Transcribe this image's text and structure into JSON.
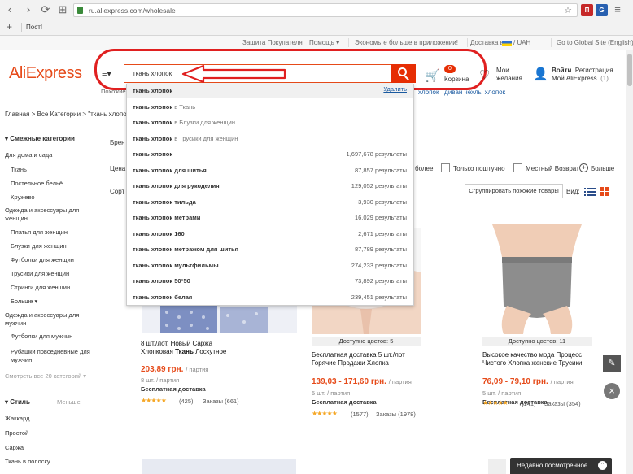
{
  "browser": {
    "url": "ru.aliexpress.com/wholesale",
    "bookmark": "Пост!"
  },
  "topbar": {
    "buyer_protection": "Защита Покупателя",
    "help": "Помощь ▾",
    "app": "Экономьте больше в приложении!",
    "delivery": "Доставка в",
    "currency": "/ UAH",
    "global_site": "Go to Global Site (English)"
  },
  "header": {
    "logo": "AliExpress",
    "category_icon": "≡▾",
    "category_label": "Похожие",
    "search_value": "ткань хлопок",
    "cart_badge": "0",
    "cart_label": "Корзина",
    "wish_label": "Мои желания",
    "login": "Войти",
    "register": "Регистрация",
    "my_ali": "Мой AliExpress",
    "my_ali_count": "(1)"
  },
  "breadcrumb": "Главная > Все Категории > \"ткань хлопок\"",
  "related_links": {
    "first": "хлопок",
    "second": "диван чехлы хлопок"
  },
  "dropdown": {
    "delete_label": "Удалить",
    "rows": [
      {
        "q": "ткань хлопок",
        "cat": "",
        "count": "",
        "history": true
      },
      {
        "q": "ткань хлопок",
        "cat": "в Ткань",
        "count": ""
      },
      {
        "q": "ткань хлопок",
        "cat": "в Блузки для женщин",
        "count": ""
      },
      {
        "q": "ткань хлопок",
        "cat": "в Трусики для женщин",
        "count": ""
      },
      {
        "q": "ткань хлопок",
        "cat": "",
        "count": "1,697,678 результаты"
      },
      {
        "q": "ткань хлопок для шитья",
        "cat": "",
        "count": "87,857 результаты"
      },
      {
        "q": "ткань хлопок для рукоделия",
        "cat": "",
        "count": "129,052 результаты"
      },
      {
        "q": "ткань хлопок тильда",
        "cat": "",
        "count": "3,930 результаты"
      },
      {
        "q": "ткань хлопок метрами",
        "cat": "",
        "count": "16,029 результаты"
      },
      {
        "q": "ткань хлопок 160",
        "cat": "",
        "count": "2,671 результаты"
      },
      {
        "q": "ткань хлопок метражом для шитья",
        "cat": "",
        "count": "87,789 результаты"
      },
      {
        "q": "ткань хлопок мультфильмы",
        "cat": "",
        "count": "274,233 результаты"
      },
      {
        "q": "ткань хлопок 50*50",
        "cat": "",
        "count": "73,892 результаты"
      },
      {
        "q": "ткань хлопок белая",
        "cat": "",
        "count": "239,451 результаты"
      }
    ]
  },
  "sidebar": {
    "heading": "Смежные категории",
    "items": [
      "Для дома и сада",
      "Ткань",
      "Постельное бельё",
      "Кружево",
      "Одежда и аксессуары для женщин",
      "Платья для женщин",
      "Блузки для женщин",
      "Футболки для женщин",
      "Трусики для женщин",
      "Стринги для женщин",
      "Больше",
      "Одежда и аксессуары для мужчин",
      "Футболки для мужчин",
      "Рубашки повседневные для мужчин"
    ],
    "see_all": "Смотреть все 20 категорий",
    "style_heading": "Стиль",
    "style_less": "Меньше",
    "styles": [
      "Жаккард",
      "Простой",
      "Саржа",
      "Ткань в полоску"
    ]
  },
  "filters": {
    "brand": "Брен",
    "price": "Цена",
    "sort": "Сорт",
    "more_than": "более",
    "per_piece": "Только поштучно",
    "local_return": "Местный Возврат",
    "more": "Больше",
    "group_btn": "Сгруппировать похожие товары",
    "view_label": "Вид:"
  },
  "products": [
    {
      "tag": "",
      "title_pre": "8 шт./лот, Новый Саржа Хлопковая ",
      "title_bold": "Ткань",
      "title_post": " Лоскутное",
      "price": "203,89 грн.",
      "per": "/ партия",
      "unit": "8 шт. / партия",
      "ship": "Бесплатная доставка",
      "stars": "★★★★★",
      "reviews": "(425)",
      "orders": "Заказы (661)"
    },
    {
      "tag": "Доступно цветов: 5",
      "title_pre": "Бесплатная доставка 5 шт./лот Горячие Продажи Хлопка",
      "title_bold": "",
      "title_post": "",
      "price": "139,03 - 171,60 грн.",
      "per": "/ партия",
      "unit": "5 шт. / партия",
      "ship": "Бесплатная доставка",
      "stars": "★★★★★",
      "reviews": "(1577)",
      "orders": "Заказы (1978)"
    },
    {
      "tag": "Доступно цветов: 11",
      "title_pre": "Высокое качество мода Процесс Чистого Хлопка женские Трусики",
      "title_bold": "",
      "title_post": "",
      "price": "76,09 - 79,10 грн.",
      "per": "/ партия",
      "unit": "5 шт. / партия",
      "ship": "Бесплатная доставка",
      "stars": "★★★★★",
      "reviews": "(141)",
      "orders": "Заказы (354)"
    }
  ],
  "recent": "Недавно посмотренное",
  "colors": {
    "accent": "#e64a19",
    "search_button": "#e62e04",
    "annotation": "#e02020",
    "link": "#1a5aa0"
  }
}
